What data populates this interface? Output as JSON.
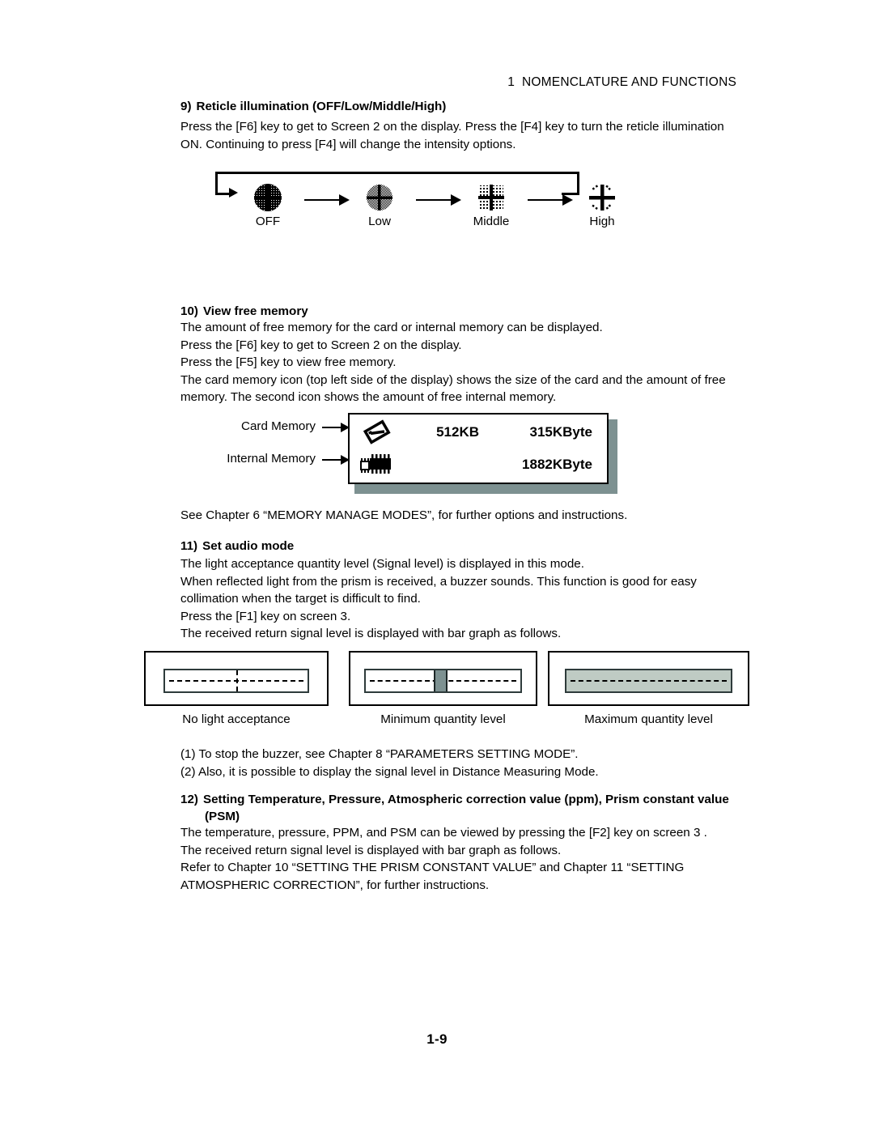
{
  "running_head": {
    "chapter_number": "1",
    "title": "NOMENCLATURE AND FUNCTIONS"
  },
  "section_9": {
    "number": "9)",
    "heading": "Reticle illumination (OFF/Low/Middle/High)",
    "line1": "Press the [F6] key to get to Screen 2 on the display. Press the [F4] key to turn the reticle illumination",
    "line2": "ON. Continuing to press [F4] will change the intensity options.",
    "diagram": {
      "steps": [
        {
          "label": "OFF",
          "icon": "reticle-off-icon"
        },
        {
          "label": "Low",
          "icon": "reticle-low-icon"
        },
        {
          "label": "Middle",
          "icon": "reticle-middle-icon"
        },
        {
          "label": "High",
          "icon": "reticle-high-icon"
        }
      ]
    }
  },
  "section_10": {
    "number": "10)",
    "heading": "View free memory",
    "line1": "The amount of free memory for the card or internal memory can be displayed.",
    "line2": "Press the [F6] key to get to Screen 2 on the display.",
    "line3": "Press the [F5] key to view free memory.",
    "line4": "The card memory icon (top left side of the display) shows the size of the card and the amount of free",
    "line5": "memory. The second icon shows the amount of free internal memory.",
    "display": {
      "card_callout": "Card Memory",
      "internal_callout": "Internal Memory",
      "card_icon": "memory-card-icon",
      "internal_icon": "memory-chip-icon",
      "card_size": "512KB",
      "card_free": "315KByte",
      "internal_size": "",
      "internal_free": "1882KByte"
    },
    "see_also": "See Chapter 6 “MEMORY MANAGE MODES”, for further options and instructions."
  },
  "section_11": {
    "number": "11)",
    "heading": "Set audio mode",
    "line1": "The light acceptance quantity level (Signal level) is displayed in this mode.",
    "line2": "When reflected light from the prism is received, a buzzer sounds. This function is good for easy",
    "line3": "collimation when the target is difficult to find.",
    "line4": "Press the [F1] key on screen 3.",
    "line5": "The received return signal level is displayed with bar graph as follows.",
    "bars": [
      {
        "caption": "No light acceptance",
        "fill_percent": 0,
        "style": "empty"
      },
      {
        "caption": "Minimum quantity level",
        "fill_percent": 8,
        "style": "segment"
      },
      {
        "caption": "Maximum quantity level",
        "fill_percent": 100,
        "style": "full"
      }
    ],
    "notes": [
      "(1) To stop the buzzer, see Chapter 8 “PARAMETERS SETTING MODE”.",
      "(2)  Also, it is possible to display the signal level in Distance Measuring Mode."
    ]
  },
  "section_12": {
    "number": "12)",
    "heading_line1": "Setting Temperature, Pressure, Atmospheric correction value (ppm), Prism constant value",
    "heading_line2": "(PSM)",
    "line1": "The temperature, pressure, PPM, and PSM can be viewed by pressing the [F2] key on screen 3 .",
    "line2": "The received return signal level is displayed with bar graph as follows.",
    "line3": "Refer to Chapter 10 “SETTING THE PRISM CONSTANT VALUE” and Chapter 11 “SETTING",
    "line4": "ATMOSPHERIC CORRECTION”, for further instructions."
  },
  "footer": {
    "page_number": "1-9"
  },
  "colors": {
    "ink": "#000000",
    "shadow": "#7d9191",
    "bar_segment": "#7d9191",
    "bar_fill": "#bfcbc4"
  }
}
